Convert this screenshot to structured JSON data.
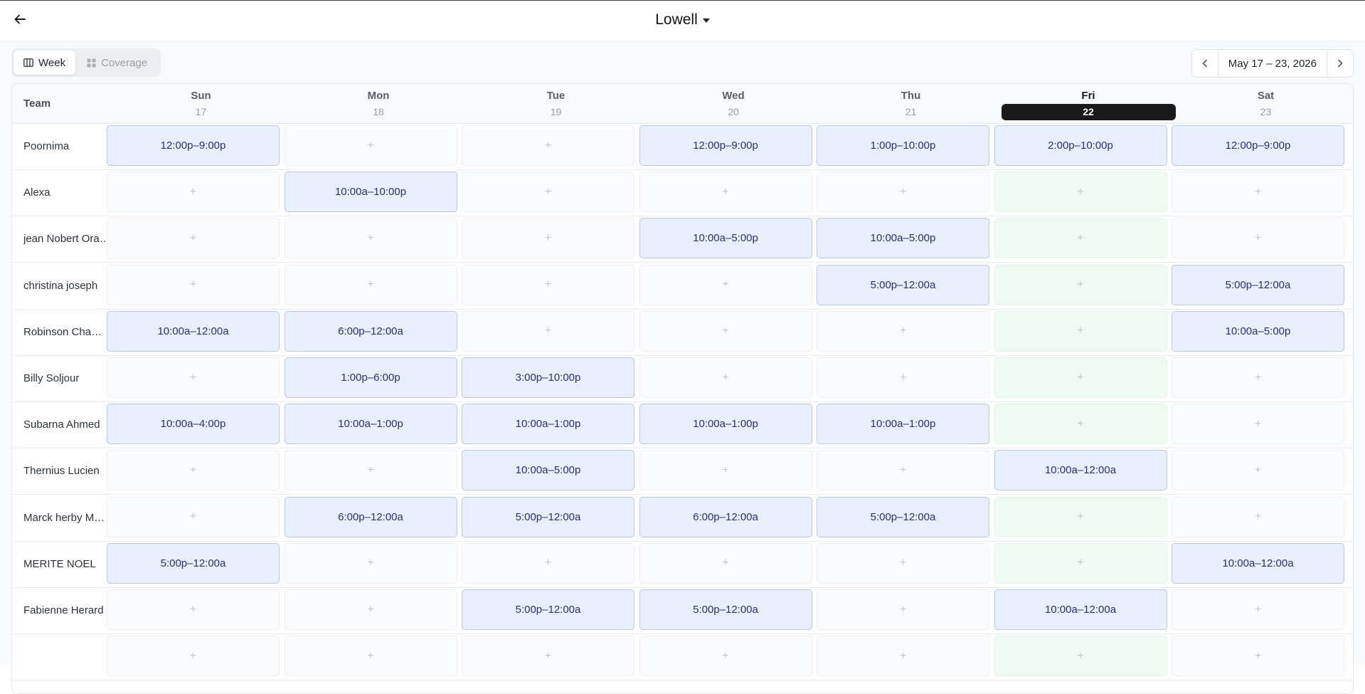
{
  "header": {
    "location": "Lowell"
  },
  "view_toggle": {
    "week_label": "Week",
    "coverage_label": "Coverage"
  },
  "date_nav": {
    "range": "May 17 – 23, 2026"
  },
  "grid": {
    "team_label": "Team",
    "days": [
      {
        "name": "Sun",
        "num": "17"
      },
      {
        "name": "Mon",
        "num": "18"
      },
      {
        "name": "Tue",
        "num": "19"
      },
      {
        "name": "Wed",
        "num": "20"
      },
      {
        "name": "Thu",
        "num": "21"
      },
      {
        "name": "Fri",
        "num": "22",
        "today": true
      },
      {
        "name": "Sat",
        "num": "23"
      }
    ],
    "empty_symbol": "+",
    "rows": [
      {
        "name": "Poornima",
        "shifts": [
          "12:00p–9:00p",
          "",
          "",
          "12:00p–9:00p",
          "1:00p–10:00p",
          "2:00p–10:00p",
          "12:00p–9:00p"
        ]
      },
      {
        "name": "Alexa",
        "shifts": [
          "",
          "10:00a–10:00p",
          "",
          "",
          "",
          "",
          ""
        ]
      },
      {
        "name": "jean Nobert Ora…",
        "shifts": [
          "",
          "",
          "",
          "10:00a–5:00p",
          "10:00a–5:00p",
          "",
          ""
        ]
      },
      {
        "name": "christina joseph",
        "shifts": [
          "",
          "",
          "",
          "",
          "5:00p–12:00a",
          "",
          "5:00p–12:00a"
        ]
      },
      {
        "name": "Robinson Cham…",
        "shifts": [
          "10:00a–12:00a",
          "6:00p–12:00a",
          "",
          "",
          "",
          "",
          "10:00a–5:00p"
        ]
      },
      {
        "name": "Billy Soljour",
        "shifts": [
          "",
          "1:00p–6:00p",
          "3:00p–10:00p",
          "",
          "",
          "",
          ""
        ]
      },
      {
        "name": "Subarna Ahmed",
        "shifts": [
          "10:00a–4:00p",
          "10:00a–1:00p",
          "10:00a–1:00p",
          "10:00a–1:00p",
          "10:00a–1:00p",
          "",
          ""
        ]
      },
      {
        "name": "Thernius Lucien",
        "shifts": [
          "",
          "",
          "10:00a–5:00p",
          "",
          "",
          "10:00a–12:00a",
          ""
        ]
      },
      {
        "name": "Marck herby M…",
        "shifts": [
          "",
          "6:00p–12:00a",
          "5:00p–12:00a",
          "6:00p–12:00a",
          "5:00p–12:00a",
          "",
          ""
        ]
      },
      {
        "name": "MERITE NOEL",
        "shifts": [
          "5:00p–12:00a",
          "",
          "",
          "",
          "",
          "",
          "10:00a–12:00a"
        ]
      },
      {
        "name": "Fabienne Herard",
        "shifts": [
          "",
          "",
          "5:00p–12:00a",
          "5:00p–12:00a",
          "",
          "10:00a–12:00a",
          ""
        ]
      },
      {
        "name": "",
        "shifts": [
          "",
          "",
          "",
          "",
          "",
          "",
          ""
        ]
      }
    ]
  }
}
